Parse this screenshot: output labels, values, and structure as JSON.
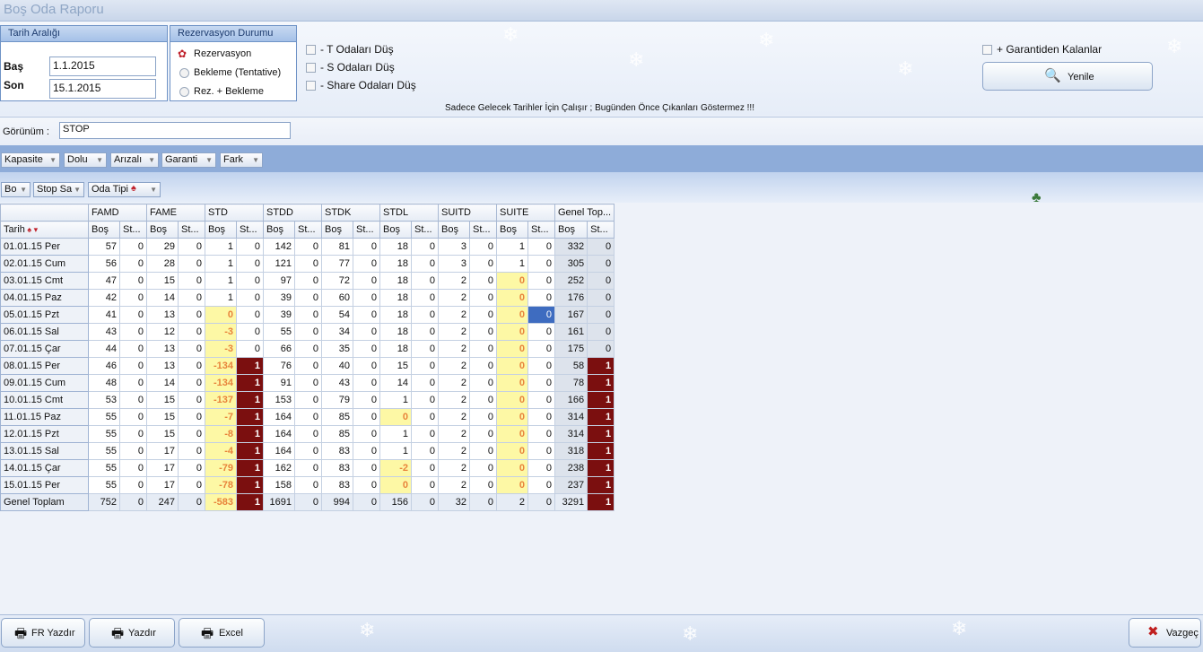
{
  "window": {
    "title": "Boş Oda Raporu"
  },
  "date_range": {
    "title": "Tarih Aralığı",
    "start_label": "Baş",
    "start_value": "1.1.2015",
    "end_label": "Son",
    "end_value": "15.1.2015"
  },
  "reservation_status": {
    "title": "Rezervasyon Durumu",
    "options": [
      "Rezervasyon",
      "Bekleme (Tentative)",
      "Rez. + Bekleme"
    ]
  },
  "checks": {
    "t_rooms": "- T Odaları Düş",
    "s_rooms": "- S Odaları Düş",
    "share_rooms": "- Share Odaları Düş",
    "guaranteed": "+ Garantiden Kalanlar"
  },
  "refresh_label": "Yenile",
  "note": "Sadece Gelecek Tarihler İçin Çalışır ; Bugünden Önce Çıkanları Göstermez !!!",
  "view": {
    "label": "Görünüm :",
    "value": "STOP"
  },
  "filters": [
    "Kapasite",
    "Dolu",
    "Arızalı",
    "Garanti",
    "Fark"
  ],
  "pivot_fields": [
    "Bo",
    "Stop Sa",
    "Oda Tipi"
  ],
  "grid": {
    "row_header": "Tarih",
    "groups": [
      "FAMD",
      "FAME",
      "STD",
      "STDD",
      "STDK",
      "STDL",
      "SUITD",
      "SUITE",
      "Genel Top..."
    ],
    "sub_headers": [
      "Boş",
      "St..."
    ],
    "rows": [
      {
        "date": "01.01.15 Per",
        "v": [
          "57",
          "0",
          "29",
          "0",
          "1",
          "0",
          "142",
          "0",
          "81",
          "0",
          "18",
          "0",
          "3",
          "0",
          "1",
          "0",
          "332",
          "0"
        ]
      },
      {
        "date": "02.01.15 Cum",
        "v": [
          "56",
          "0",
          "28",
          "0",
          "1",
          "0",
          "121",
          "0",
          "77",
          "0",
          "18",
          "0",
          "3",
          "0",
          "1",
          "0",
          "305",
          "0"
        ]
      },
      {
        "date": "03.01.15 Cmt",
        "v": [
          "47",
          "0",
          "15",
          "0",
          "1",
          "0",
          "97",
          "0",
          "72",
          "0",
          "18",
          "0",
          "2",
          "0",
          "0",
          "0",
          "252",
          "0"
        ]
      },
      {
        "date": "04.01.15 Paz",
        "v": [
          "42",
          "0",
          "14",
          "0",
          "1",
          "0",
          "39",
          "0",
          "60",
          "0",
          "18",
          "0",
          "2",
          "0",
          "0",
          "0",
          "176",
          "0"
        ]
      },
      {
        "date": "05.01.15 Pzt",
        "v": [
          "41",
          "0",
          "13",
          "0",
          "0",
          "0",
          "39",
          "0",
          "54",
          "0",
          "18",
          "0",
          "2",
          "0",
          "0",
          "0",
          "167",
          "0"
        ]
      },
      {
        "date": "06.01.15 Sal",
        "v": [
          "43",
          "0",
          "12",
          "0",
          "-3",
          "0",
          "55",
          "0",
          "34",
          "0",
          "18",
          "0",
          "2",
          "0",
          "0",
          "0",
          "161",
          "0"
        ]
      },
      {
        "date": "07.01.15 Çar",
        "v": [
          "44",
          "0",
          "13",
          "0",
          "-3",
          "0",
          "66",
          "0",
          "35",
          "0",
          "18",
          "0",
          "2",
          "0",
          "0",
          "0",
          "175",
          "0"
        ]
      },
      {
        "date": "08.01.15 Per",
        "v": [
          "46",
          "0",
          "13",
          "0",
          "-134",
          "1",
          "76",
          "0",
          "40",
          "0",
          "15",
          "0",
          "2",
          "0",
          "0",
          "0",
          "58",
          "1"
        ]
      },
      {
        "date": "09.01.15 Cum",
        "v": [
          "48",
          "0",
          "14",
          "0",
          "-134",
          "1",
          "91",
          "0",
          "43",
          "0",
          "14",
          "0",
          "2",
          "0",
          "0",
          "0",
          "78",
          "1"
        ]
      },
      {
        "date": "10.01.15 Cmt",
        "v": [
          "53",
          "0",
          "15",
          "0",
          "-137",
          "1",
          "153",
          "0",
          "79",
          "0",
          "1",
          "0",
          "2",
          "0",
          "0",
          "0",
          "166",
          "1"
        ]
      },
      {
        "date": "11.01.15 Paz",
        "v": [
          "55",
          "0",
          "15",
          "0",
          "-7",
          "1",
          "164",
          "0",
          "85",
          "0",
          "0",
          "0",
          "2",
          "0",
          "0",
          "0",
          "314",
          "1"
        ]
      },
      {
        "date": "12.01.15 Pzt",
        "v": [
          "55",
          "0",
          "15",
          "0",
          "-8",
          "1",
          "164",
          "0",
          "85",
          "0",
          "1",
          "0",
          "2",
          "0",
          "0",
          "0",
          "314",
          "1"
        ]
      },
      {
        "date": "13.01.15 Sal",
        "v": [
          "55",
          "0",
          "17",
          "0",
          "-4",
          "1",
          "164",
          "0",
          "83",
          "0",
          "1",
          "0",
          "2",
          "0",
          "0",
          "0",
          "318",
          "1"
        ]
      },
      {
        "date": "14.01.15 Çar",
        "v": [
          "55",
          "0",
          "17",
          "0",
          "-79",
          "1",
          "162",
          "0",
          "83",
          "0",
          "-2",
          "0",
          "2",
          "0",
          "0",
          "0",
          "238",
          "1"
        ]
      },
      {
        "date": "15.01.15 Per",
        "v": [
          "55",
          "0",
          "17",
          "0",
          "-78",
          "1",
          "158",
          "0",
          "83",
          "0",
          "0",
          "0",
          "2",
          "0",
          "0",
          "0",
          "237",
          "1"
        ]
      }
    ],
    "total": {
      "label": "Genel Toplam",
      "v": [
        "752",
        "0",
        "247",
        "0",
        "-583",
        "1",
        "1691",
        "0",
        "994",
        "0",
        "156",
        "0",
        "32",
        "0",
        "2",
        "0",
        "3291",
        "1"
      ]
    }
  },
  "buttons": {
    "fr_print": "FR Yazdır",
    "print": "Yazdır",
    "excel": "Excel",
    "cancel": "Vazgeç"
  }
}
